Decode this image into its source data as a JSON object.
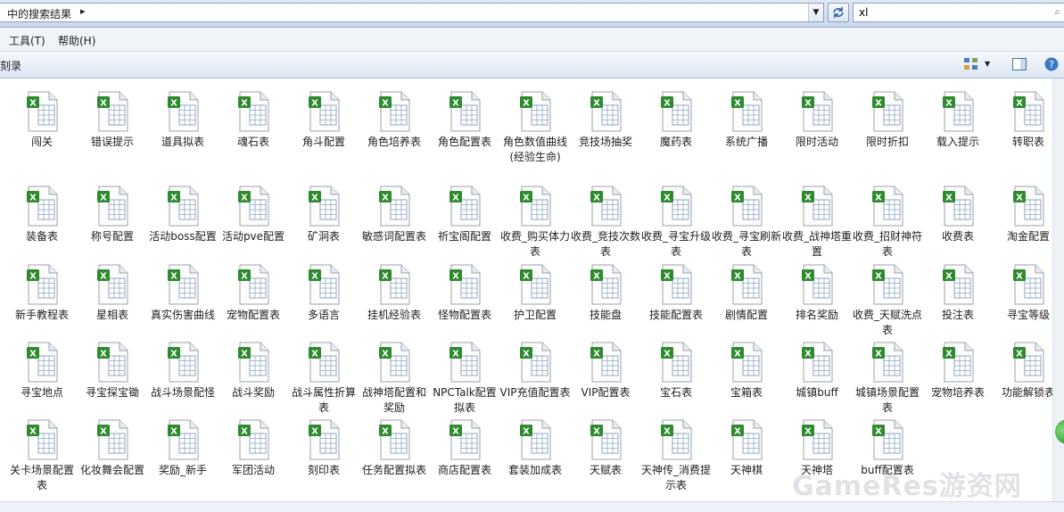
{
  "address": {
    "breadcrumb": "中的搜索结果",
    "separator": "▸"
  },
  "search": {
    "value": "xl"
  },
  "menu": {
    "tools": "工具(T)",
    "help": "帮助(H)"
  },
  "command": {
    "burn": "刻录"
  },
  "icon_names": {
    "file": "excel-file-icon"
  },
  "colors": {
    "accent": "#2d8a2d",
    "header": "#dfe9f5"
  },
  "watermark": "GameRes游资网",
  "files": [
    [
      "闯关",
      "错误提示",
      "道具拟表",
      "魂石表",
      "角斗配置",
      "角色培养表",
      "角色配置表",
      "角色数值曲线(经验生命)",
      "竞技场抽奖",
      "魔药表",
      "系统广播",
      "限时活动",
      "限时折扣",
      "载入提示",
      "转职表"
    ],
    [
      "装备表",
      "称号配置",
      "活动boss配置",
      "活动pve配置",
      "矿洞表",
      "敏感词配置表",
      "祈宝阁配置",
      "收费_购买体力表",
      "收费_竞技次数表",
      "收费_寻宝升级表",
      "收费_寻宝刷新表",
      "收费_战神塔重置",
      "收费_招财神符表",
      "收费表",
      "淘金配置"
    ],
    [
      "新手教程表",
      "星相表",
      "真实伤害曲线",
      "宠物配置表",
      "多语言",
      "挂机经验表",
      "怪物配置表",
      "护卫配置",
      "技能盘",
      "技能配置表",
      "剧情配置",
      "排名奖励",
      "收费_天赋洗点表",
      "投注表",
      "寻宝等级"
    ],
    [
      "寻宝地点",
      "寻宝探宝锄",
      "战斗场景配怪",
      "战斗奖励",
      "战斗属性折算表",
      "战神塔配置和奖励",
      "NPCTalk配置拟表",
      "VIP充值配置表",
      "VIP配置表",
      "宝石表",
      "宝箱表",
      "城镇buff",
      "城镇场景配置表",
      "宠物培养表",
      "功能解锁表"
    ],
    [
      "关卡场景配置表",
      "化妆舞会配置",
      "奖励_新手",
      "军团活动",
      "刻印表",
      "任务配置拟表",
      "商店配置表",
      "套装加成表",
      "天赋表",
      "天神传_消费提示表",
      "天神棋",
      "天神塔",
      "buff配置表"
    ]
  ]
}
